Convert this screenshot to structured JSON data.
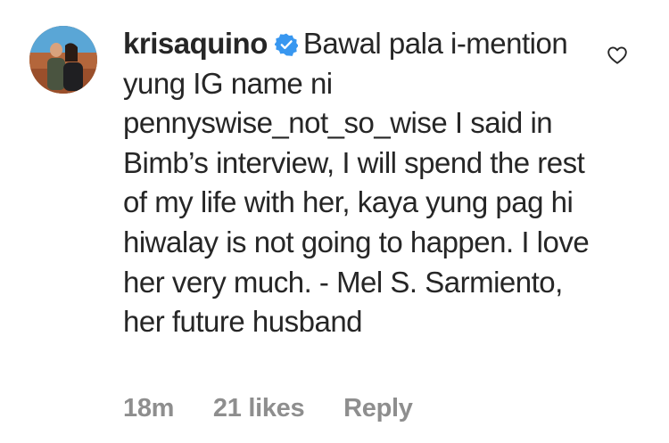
{
  "comment": {
    "username": "krisaquino",
    "verified_icon": "verified-badge-icon",
    "text": "Bawal pala i-mention yung IG name ni pennyswise_not_so_wise I said in Bimb’s interview, I will spend the rest of my life with her, kaya yung pag hi hiwalay is not going to happen. I love her very much. - Mel S. Sarmiento, her future husband",
    "time": "18m",
    "likes": "21 likes",
    "reply_label": "Reply",
    "like_icon": "heart-outline-icon"
  },
  "colors": {
    "text": "#262626",
    "secondary": "#8e8e8e",
    "verified": "#3897f0"
  }
}
